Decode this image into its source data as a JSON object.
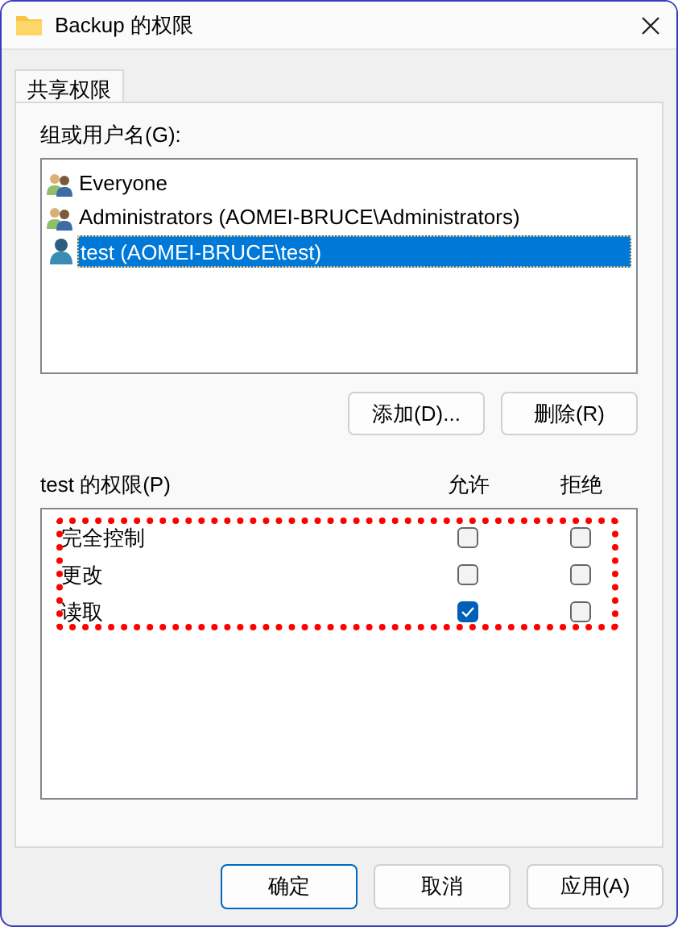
{
  "window": {
    "title": "Backup 的权限"
  },
  "tabs": [
    {
      "label": "共享权限",
      "selected": true
    }
  ],
  "users": {
    "label": "组或用户名(G):",
    "items": [
      {
        "name": "Everyone",
        "kind": "group",
        "selected": false
      },
      {
        "name": "Administrators (AOMEI-BRUCE\\Administrators)",
        "kind": "group",
        "selected": false
      },
      {
        "name": "test (AOMEI-BRUCE\\test)",
        "kind": "user",
        "selected": true
      }
    ],
    "buttons": [
      "添加(D)...",
      "删除(R)"
    ]
  },
  "permissions": {
    "label": "test 的权限(P)",
    "columns": [
      "允许",
      "拒绝"
    ],
    "highlighted": true,
    "rows": [
      {
        "name": "完全控制",
        "allow": false,
        "deny": false
      },
      {
        "name": "更改",
        "allow": false,
        "deny": false
      },
      {
        "name": "读取",
        "allow": true,
        "deny": false
      }
    ]
  },
  "buttons": [
    {
      "label": "确定",
      "default": true
    },
    {
      "label": "取消",
      "default": false
    },
    {
      "label": "应用(A)",
      "default": false
    }
  ]
}
